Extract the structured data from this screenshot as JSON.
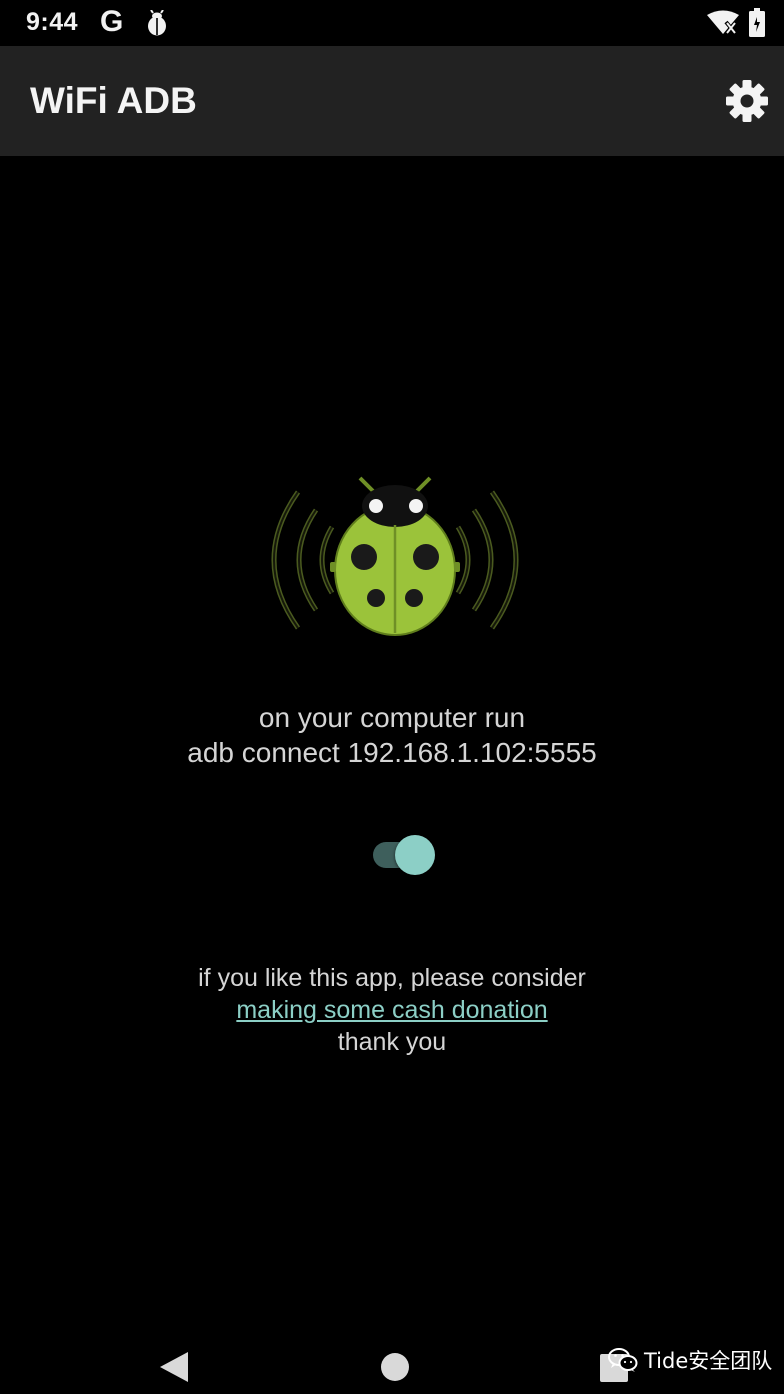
{
  "status_bar": {
    "time": "9:44",
    "google_glyph": "G",
    "icons": [
      "google-icon",
      "bug-icon",
      "wifi-off-icon",
      "battery-icon"
    ]
  },
  "app_bar": {
    "title": "WiFi ADB",
    "settings_icon": "gear-icon"
  },
  "main": {
    "logo_icon": "ladybug-wifi-logo",
    "instruction_line1": "on your computer run",
    "instruction_line2": "adb connect 192.168.1.102:5555",
    "toggle_on": true,
    "donation_line1": "if you like this app, please consider",
    "donation_link": "making some cash donation",
    "donation_line3": "thank you"
  },
  "nav_bar": {
    "buttons": [
      "back-icon",
      "home-icon",
      "recents-icon"
    ]
  },
  "watermark": {
    "text": "Tide安全团队"
  },
  "colors": {
    "background": "#000000",
    "app_bar": "#222222",
    "accent": "#8ccfc6",
    "logo_green": "#9bc33a",
    "text": "#d5d5d5"
  }
}
